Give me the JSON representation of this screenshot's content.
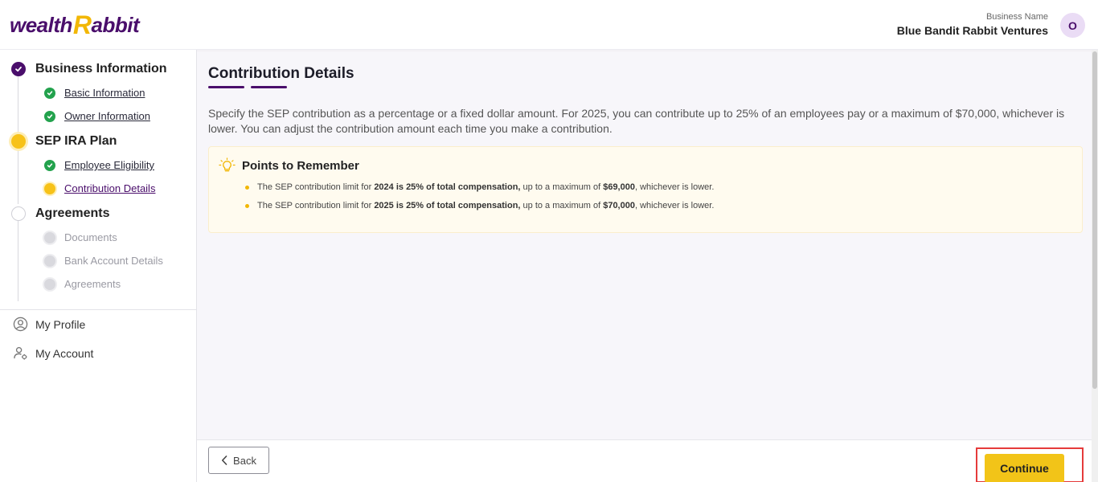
{
  "header": {
    "logo": {
      "part1": "wealth",
      "part2": "R",
      "part3": "abbit"
    },
    "business_label": "Business Name",
    "business_name": "Blue Bandit Rabbit Ventures",
    "avatar_initial": "O"
  },
  "sidebar": {
    "steps": [
      {
        "label": "Business Information",
        "state": "done",
        "items": [
          {
            "label": "Basic Information",
            "state": "done"
          },
          {
            "label": "Owner Information",
            "state": "done"
          }
        ]
      },
      {
        "label": "SEP IRA Plan",
        "state": "active",
        "items": [
          {
            "label": "Employee Eligibility",
            "state": "done"
          },
          {
            "label": "Contribution Details",
            "state": "active"
          }
        ]
      },
      {
        "label": "Agreements",
        "state": "todo",
        "items": [
          {
            "label": "Documents",
            "state": "todo"
          },
          {
            "label": "Bank Account Details",
            "state": "todo"
          },
          {
            "label": "Agreements",
            "state": "todo"
          }
        ]
      }
    ],
    "nav": [
      {
        "label": "My Profile",
        "icon": "user-circle-icon"
      },
      {
        "label": "My Account",
        "icon": "user-gear-icon"
      }
    ]
  },
  "main": {
    "title": "Contribution Details",
    "description": "Specify the SEP contribution as a percentage or a fixed dollar amount. For 2025, you can contribute up to 25% of an employees pay or a maximum of $70,000, whichever is lower. You can adjust the contribution amount each time you make a contribution.",
    "points": {
      "title": "Points to Remember",
      "items": [
        {
          "prefix": "The SEP contribution limit for ",
          "bold1": "2024 is 25% of total compensation,",
          "mid": " up to a maximum of ",
          "bold2": "$69,000",
          "suffix": ", whichever is lower."
        },
        {
          "prefix": "The SEP contribution limit for ",
          "bold1": "2025 is 25% of total compensation,",
          "mid": " up to a maximum of ",
          "bold2": "$70,000",
          "suffix": ", whichever is lower."
        }
      ]
    }
  },
  "footer": {
    "back_label": "Back",
    "continue_label": "Continue"
  },
  "colors": {
    "brand_purple": "#4a0e6b",
    "brand_yellow": "#f2b705",
    "done_green": "#23a24d",
    "highlight_red": "#e53b3b"
  }
}
